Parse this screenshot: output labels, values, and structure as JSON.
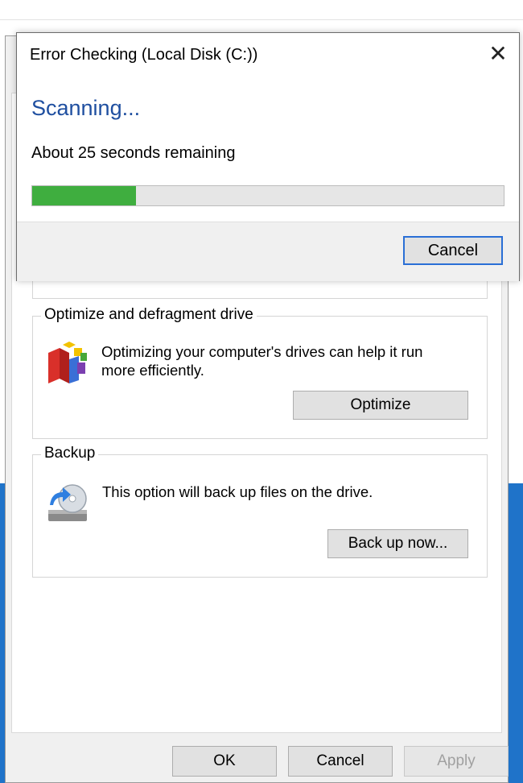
{
  "dialog": {
    "title": "Error Checking (Local Disk (C:))",
    "close_glyph": "✕",
    "heading": "Scanning...",
    "remaining": "About 25 seconds remaining",
    "progress_fraction": 0.22,
    "cancel_label": "Cancel",
    "progress_color": "#3fae3f",
    "heading_color": "#1f4fa0"
  },
  "optimize": {
    "title": "Optimize and defragment drive",
    "description": "Optimizing your computer's drives can help it run more efficiently.",
    "button_label": "Optimize",
    "icon": "defragment-icon"
  },
  "backup": {
    "title": "Backup",
    "description": "This option will back up files on the drive.",
    "button_label": "Back up now...",
    "icon": "backup-drive-icon"
  },
  "footer": {
    "ok_label": "OK",
    "cancel_label": "Cancel",
    "apply_label": "Apply"
  }
}
